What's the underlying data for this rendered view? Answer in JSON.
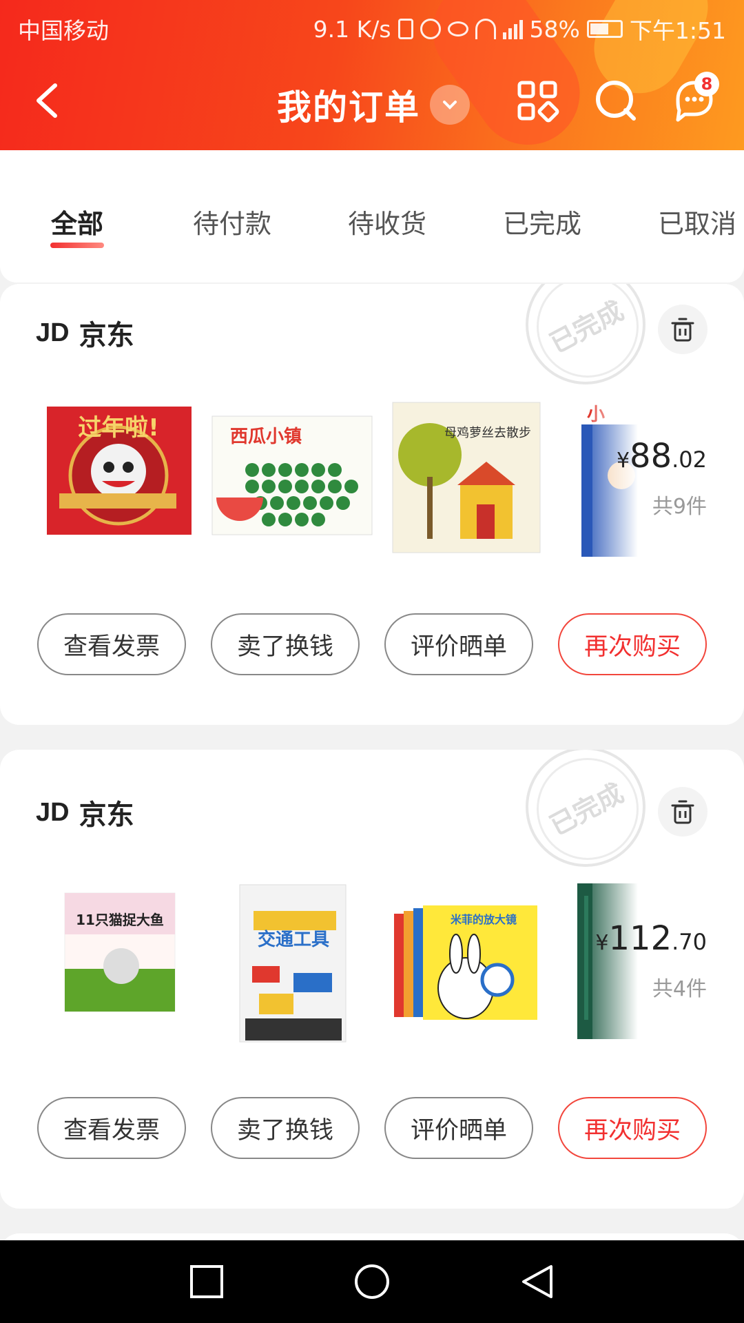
{
  "status_bar": {
    "carrier": "中国移动",
    "speed": "9.1 K/s",
    "battery": "58%",
    "time": "下午1:51"
  },
  "header": {
    "title": "我的订单",
    "message_badge": "8",
    "icons": [
      "back-arrow-icon",
      "chevron-down-icon",
      "grid-apps-icon",
      "search-icon",
      "message-icon"
    ]
  },
  "tabs": [
    {
      "label": "全部",
      "active": true
    },
    {
      "label": "待付款",
      "active": false
    },
    {
      "label": "待收货",
      "active": false
    },
    {
      "label": "已完成",
      "active": false
    },
    {
      "label": "已取消",
      "active": false
    }
  ],
  "orders": [
    {
      "shop_logo": "JD",
      "shop_name": "京东",
      "stamp": "已完成",
      "price_symbol": "¥",
      "price_int": "88",
      "price_dec": ".02",
      "count": "共9件",
      "products": [
        {
          "cover_text": "过年啦!"
        },
        {
          "cover_text": "西瓜小镇"
        },
        {
          "cover_text": "母鸡萝丝去散步"
        },
        {
          "cover_text": "小"
        }
      ],
      "buttons": [
        "查看发票",
        "卖了换钱",
        "评价晒单",
        "再次购买"
      ]
    },
    {
      "shop_logo": "JD",
      "shop_name": "京东",
      "stamp": "已完成",
      "price_symbol": "¥",
      "price_int": "112",
      "price_dec": ".70",
      "count": "共4件",
      "products": [
        {
          "cover_text": "11只猫捉大鱼"
        },
        {
          "cover_text": "交通工具"
        },
        {
          "cover_text": "米菲的放大镜"
        },
        {
          "cover_text": ""
        }
      ],
      "buttons": [
        "查看发票",
        "卖了换钱",
        "评价晒单",
        "再次购买"
      ]
    }
  ],
  "colors": {
    "accent": "#f23030",
    "header_start": "#f5291c",
    "header_end": "#fe9a1f"
  },
  "system_nav": [
    "recent-apps-icon",
    "home-icon",
    "back-icon"
  ]
}
